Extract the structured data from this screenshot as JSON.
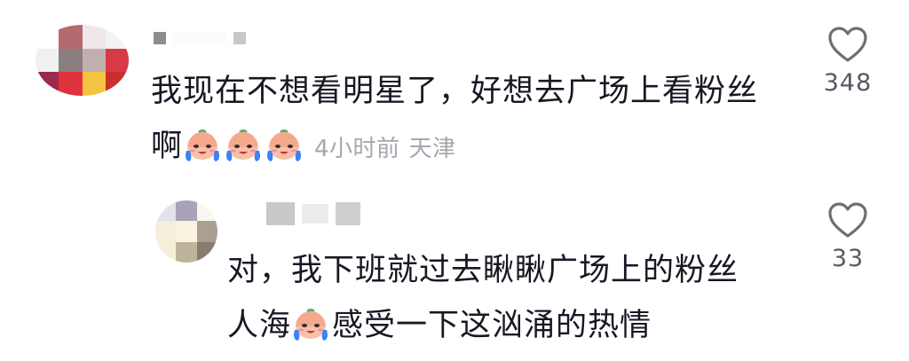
{
  "comments": [
    {
      "text_line1": "我现在不想看明星了，好想去广场上看粉丝",
      "text_line2_prefix": "啊",
      "time": "4小时前",
      "location": "天津",
      "likes": "348",
      "emoji_name": "crying-face-emoji",
      "emoji_count": 3
    },
    {
      "text_line1": "对，我下班就过去瞅瞅广场上的粉丝",
      "text_line2_prefix": "人海",
      "text_line2_suffix": "感受一下这汹涌的热情",
      "likes": "33",
      "emoji_name": "crying-face-emoji",
      "emoji_count": 1
    }
  ],
  "colors": {
    "text": "#161823",
    "meta": "#a4a7ad",
    "like_count": "#555a63",
    "heart_outline": "#6b6f77"
  },
  "icons": {
    "like": "heart-outline-icon",
    "avatar": "pixelated-avatar"
  }
}
